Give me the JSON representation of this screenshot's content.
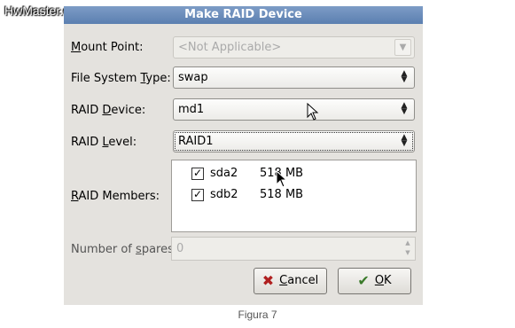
{
  "watermark": "HwMaster.com",
  "window": {
    "title": "Make RAID Device"
  },
  "fields": {
    "mount_point": {
      "label_pre": "",
      "label_u": "M",
      "label_post": "ount Point:",
      "value": "<Not Applicable>"
    },
    "fs_type": {
      "label_pre": "File System ",
      "label_u": "T",
      "label_post": "ype:",
      "value": "swap"
    },
    "raid_device": {
      "label_pre": "RAID ",
      "label_u": "D",
      "label_post": "evice:",
      "value": "md1"
    },
    "raid_level": {
      "label_pre": "RAID ",
      "label_u": "L",
      "label_post": "evel:",
      "value": "RAID1"
    },
    "raid_members": {
      "label_pre": "",
      "label_u": "R",
      "label_post": "AID Members:"
    },
    "spares": {
      "label_pre": "Number of ",
      "label_u": "s",
      "label_post": "pares:",
      "value": "0"
    }
  },
  "members": [
    {
      "name": "sda2",
      "size": "518 MB",
      "checked": true
    },
    {
      "name": "sdb2",
      "size": "518 MB",
      "checked": true
    }
  ],
  "buttons": {
    "cancel": {
      "pre": "",
      "u": "C",
      "post": "ancel"
    },
    "ok": {
      "pre": "",
      "u": "O",
      "post": "K"
    }
  },
  "caption": "Figura 7"
}
